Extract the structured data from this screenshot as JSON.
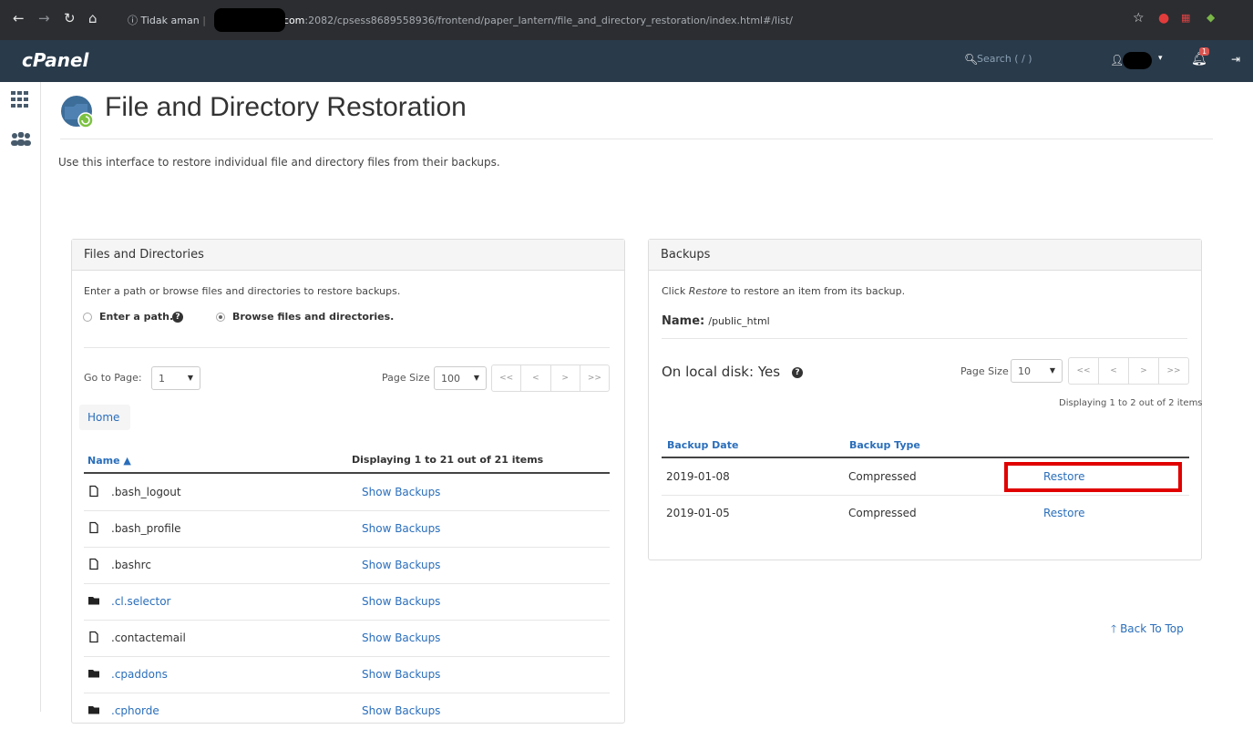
{
  "browser": {
    "security_label": "Tidak aman",
    "url_host_suffix": ".com",
    "url_path": ":2082/cpsess8689558936/frontend/paper_lantern/file_and_directory_restoration/index.html#/list/"
  },
  "header": {
    "logo": "cPanel",
    "search_placeholder": "Search ( / )",
    "notification_count": "1"
  },
  "page": {
    "title": "File and Directory Restoration",
    "description": "Use this interface to restore individual file and directory files from their backups."
  },
  "files_panel": {
    "heading": "Files and Directories",
    "instruction": "Enter a path or browse files and directories to restore backups.",
    "radio_path_label": "Enter a path.",
    "radio_browse_label": "Browse files and directories.",
    "selected_mode": "browse",
    "go_to_page_label": "Go to Page:",
    "go_to_page_value": "1",
    "page_size_label": "Page Size",
    "page_size_value": "100",
    "pager": [
      "<<",
      "<",
      ">",
      ">>"
    ],
    "breadcrumb_home": "Home",
    "col_name": "Name ▲",
    "displaying": "Displaying 1 to 21 out of 21 items",
    "show_backups_label": "Show Backups",
    "items": [
      {
        "name": ".bash_logout",
        "type": "file"
      },
      {
        "name": ".bash_profile",
        "type": "file"
      },
      {
        "name": ".bashrc",
        "type": "file"
      },
      {
        "name": ".cl.selector",
        "type": "folder"
      },
      {
        "name": ".contactemail",
        "type": "file"
      },
      {
        "name": ".cpaddons",
        "type": "folder"
      },
      {
        "name": ".cphorde",
        "type": "folder"
      }
    ]
  },
  "backups_panel": {
    "heading": "Backups",
    "instruction_pre": "Click ",
    "instruction_em": "Restore",
    "instruction_post": " to restore an item from its backup.",
    "name_label": "Name:",
    "name_value": "/public_html",
    "local_disk": "On local disk: Yes",
    "page_size_label": "Page Size",
    "page_size_value": "10",
    "pager": [
      "<<",
      "<",
      ">",
      ">>"
    ],
    "displaying": "Displaying 1 to 2 out of 2 items",
    "col_date": "Backup Date",
    "col_type": "Backup Type",
    "rows": [
      {
        "date": "2019-01-08",
        "type": "Compressed",
        "action": "Restore"
      },
      {
        "date": "2019-01-05",
        "type": "Compressed",
        "action": "Restore"
      }
    ]
  },
  "back_to_top": "Back To Top",
  "colors": {
    "link": "#2a6ebb",
    "header_bg": "#293a4a",
    "highlight": "#e00000"
  }
}
